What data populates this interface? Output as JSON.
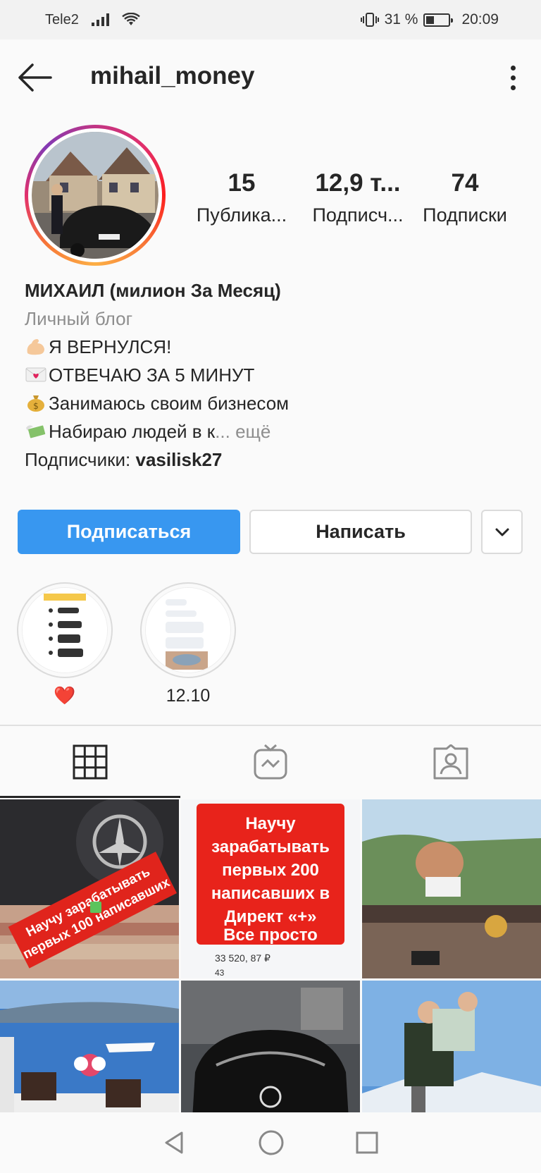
{
  "status_bar": {
    "carrier": "Tele2",
    "battery_percent": "31 %",
    "time": "20:09"
  },
  "header": {
    "username": "mihail_money"
  },
  "stats": [
    {
      "value": "15",
      "label": "Публика..."
    },
    {
      "value": "12,9 т...",
      "label": "Подписч..."
    },
    {
      "value": "74",
      "label": "Подписки"
    }
  ],
  "bio": {
    "name": "МИХАИЛ (милион За Месяц)",
    "category": "Личный блог",
    "lines": [
      {
        "emoji": "flexed-biceps-emoji",
        "text": "Я ВЕРНУЛСЯ!"
      },
      {
        "emoji": "love-letter-emoji",
        "text": "ОТВЕЧАЮ ЗА 5 МИНУТ"
      },
      {
        "emoji": "money-bag-emoji",
        "text": "Занимаюсь своим бизнесом"
      },
      {
        "emoji": "money-wings-emoji",
        "text": "Набираю людей в к"
      }
    ],
    "more_ellipsis": "...",
    "more_label": " ещё",
    "followers_prefix": "Подписчики: ",
    "followers_name": "vasilisk27"
  },
  "buttons": {
    "follow": "Подписаться",
    "message": "Написать"
  },
  "highlights": [
    {
      "label": "❤️"
    },
    {
      "label": "12.10"
    }
  ],
  "posts": [
    {
      "caption": "Научу зарабатывать первых 100 написавших"
    },
    {
      "caption": "Научу зарабатывать первых 200 написавших в Директ «+» Все просто",
      "amount": "33 520, 87 ₽",
      "count": "43"
    },
    {
      "caption": ""
    },
    {
      "caption": ""
    },
    {
      "caption": ""
    },
    {
      "caption": ""
    }
  ],
  "colors": {
    "accent": "#3897f0",
    "text": "#262626",
    "secondary": "#8e8e8e",
    "post_text_red": "#e8231b"
  }
}
